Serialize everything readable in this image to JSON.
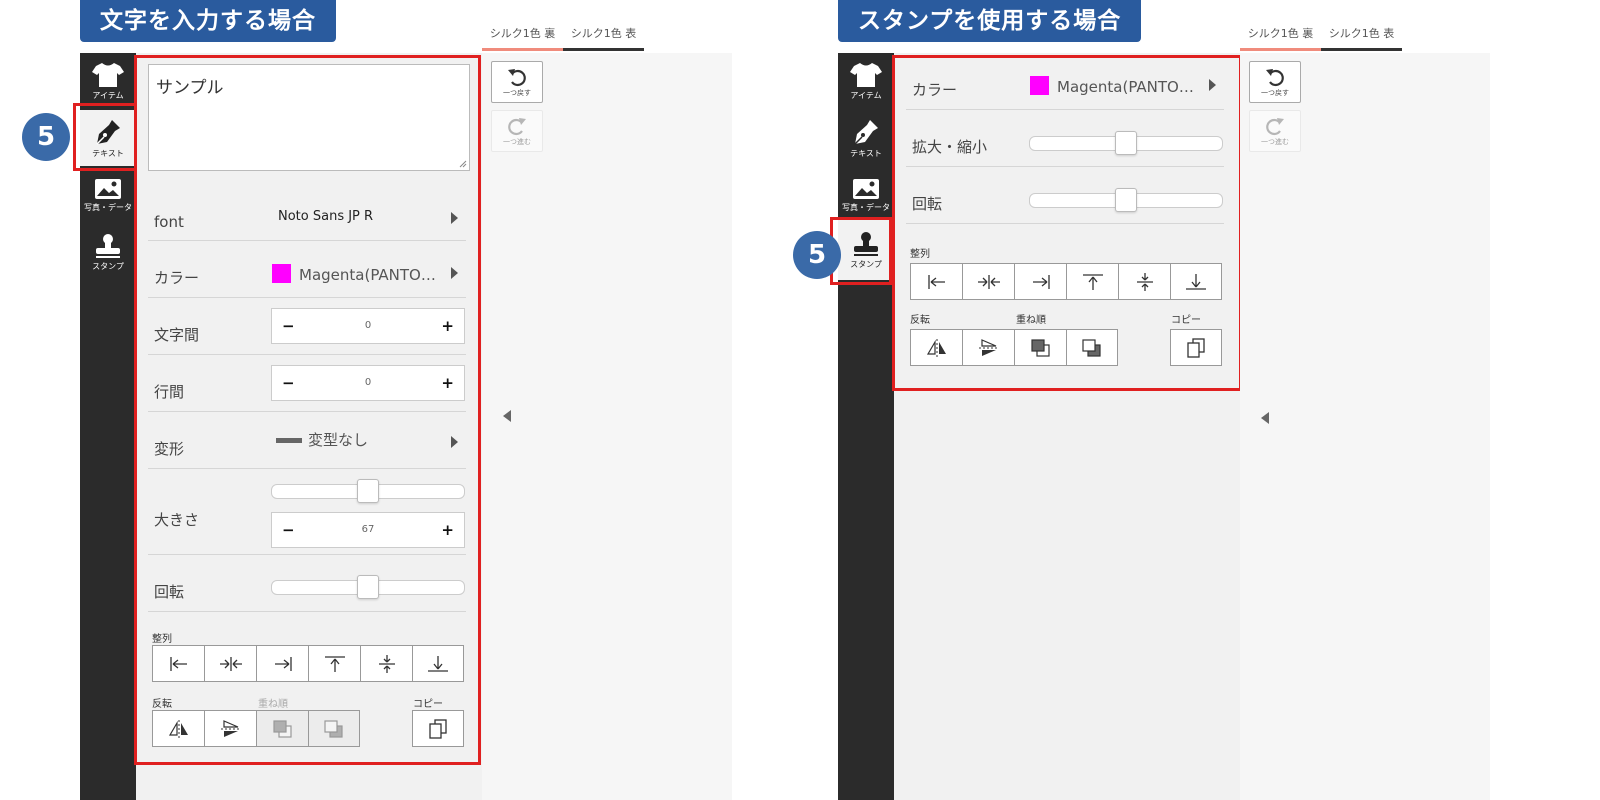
{
  "step_number": "5",
  "left": {
    "title": "文字を入力する場合",
    "sidebar": [
      {
        "label": "アイテム",
        "icon": "tshirt-icon"
      },
      {
        "label": "テキスト",
        "icon": "pen-nib-icon"
      },
      {
        "label": "写真・データ",
        "icon": "image-icon"
      },
      {
        "label": "スタンプ",
        "icon": "stamp-icon"
      }
    ],
    "text_value": "サンプル",
    "font": {
      "label": "font",
      "value": "Noto Sans JP R"
    },
    "color": {
      "label": "カラー",
      "value": "Magenta(PANTO…",
      "swatch": "#ff00ff"
    },
    "letter_spacing": {
      "label": "文字間",
      "minus": "−",
      "value": "0",
      "plus": "+"
    },
    "line_spacing": {
      "label": "行間",
      "minus": "−",
      "value": "0",
      "plus": "+"
    },
    "transform": {
      "label": "変形",
      "value": "変型なし"
    },
    "size": {
      "label": "大きさ",
      "minus": "−",
      "value": "67",
      "plus": "+",
      "slider_fraction": 0.5
    },
    "rotation": {
      "label": "回転",
      "slider_fraction": 0.5
    },
    "align_label": "整列",
    "flip_label": "反転",
    "order_label": "重ね順",
    "copy_label": "コピー",
    "tabs": [
      "シルク1色 裏",
      "シルク1色 表"
    ],
    "undo_label": "一つ戻す",
    "redo_label": "一つ進む"
  },
  "right": {
    "title": "スタンプを使用する場合",
    "sidebar": [
      {
        "label": "アイテム",
        "icon": "tshirt-icon"
      },
      {
        "label": "テキスト",
        "icon": "pen-nib-icon"
      },
      {
        "label": "写真・データ",
        "icon": "image-icon"
      },
      {
        "label": "スタンプ",
        "icon": "stamp-icon"
      }
    ],
    "color": {
      "label": "カラー",
      "value": "Magenta(PANTO…",
      "swatch": "#ff00ff"
    },
    "scale": {
      "label": "拡大・縮小",
      "slider_fraction": 0.5
    },
    "rotation": {
      "label": "回転",
      "slider_fraction": 0.5
    },
    "align_label": "整列",
    "flip_label": "反転",
    "order_label": "重ね順",
    "copy_label": "コピー",
    "tabs": [
      "シルク1色 裏",
      "シルク1色 表"
    ],
    "undo_label": "一つ戻す",
    "redo_label": "一つ進む"
  },
  "colors": {
    "accent_blue": "#2a5b9e",
    "highlight_red": "#e02020",
    "sidebar_dark": "#2b2b2b",
    "magenta": "#ff00ff"
  }
}
